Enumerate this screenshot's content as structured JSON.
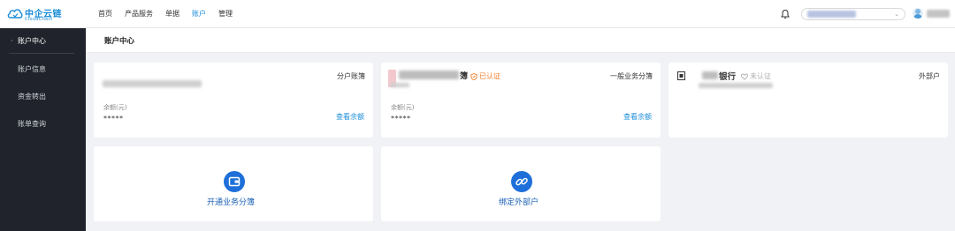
{
  "logo": {
    "text": "中企云链",
    "subtext": "CloudChain"
  },
  "nav": [
    {
      "label": "首页"
    },
    {
      "label": "产品服务"
    },
    {
      "label": "单据"
    },
    {
      "label": "账户"
    },
    {
      "label": "管理"
    }
  ],
  "header_right": {
    "bell_icon": "bell-icon",
    "account_chevron": "⌄"
  },
  "sidebar": {
    "title": "账户中心",
    "items": [
      {
        "label": "账户信息"
      },
      {
        "label": "资金转出"
      },
      {
        "label": "账单查询"
      }
    ]
  },
  "page": {
    "title": "账户中心"
  },
  "cards": [
    {
      "type_label": "分户账簿",
      "balance_label": "余额(元)",
      "balance_value": "*****",
      "view_link": "查看余额"
    },
    {
      "name_suffix": "簿",
      "cert": "已认证",
      "type_label": "一般业务分簿",
      "balance_label": "余额(元)",
      "balance_value": "*****",
      "view_link": "查看余额"
    },
    {
      "bank_name": "银行",
      "cert": "未认证",
      "type_label": "外部户"
    }
  ],
  "actions": [
    {
      "label": "开通业务分簿",
      "icon": "wallet-icon"
    },
    {
      "label": "绑定外部户",
      "icon": "link-icon"
    }
  ],
  "colors": {
    "accent": "#1a8cd8",
    "certified": "#f07c29",
    "sidebar": "#20232b"
  }
}
